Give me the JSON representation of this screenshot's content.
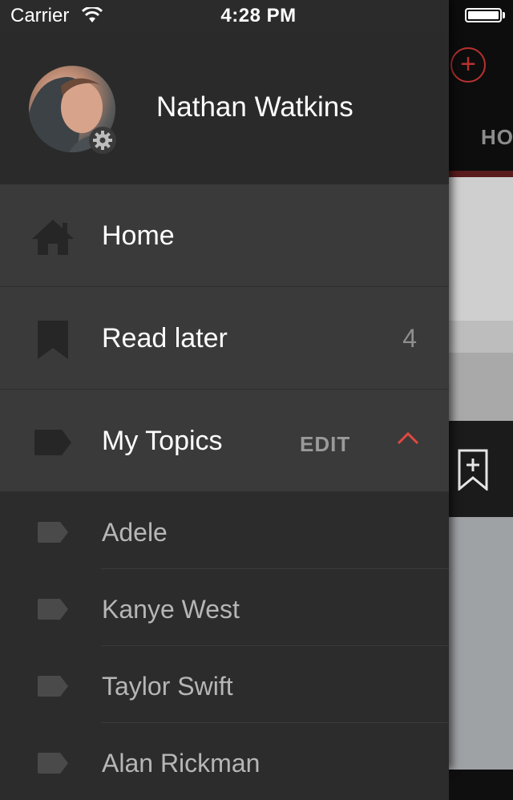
{
  "status_bar": {
    "carrier": "Carrier",
    "time": "4:28 PM"
  },
  "profile": {
    "name": "Nathan Watkins"
  },
  "menu": {
    "home": {
      "label": "Home",
      "icon": "home-icon"
    },
    "read_later": {
      "label": "Read later",
      "count": "4",
      "icon": "bookmark-icon"
    },
    "my_topics": {
      "label": "My Topics",
      "edit_label": "EDIT",
      "icon": "tag-icon",
      "accent": "#e0493f"
    }
  },
  "topics": [
    {
      "label": "Adele"
    },
    {
      "label": "Kanye West"
    },
    {
      "label": "Taylor Swift"
    },
    {
      "label": "Alan Rickman"
    }
  ],
  "background_app": {
    "tab_label": "HOME",
    "accent": "#b7322f"
  },
  "colors": {
    "drawer_bg": "#2b2b2b",
    "menu_bg": "#3a3a3a",
    "accent_red": "#e0493f"
  }
}
